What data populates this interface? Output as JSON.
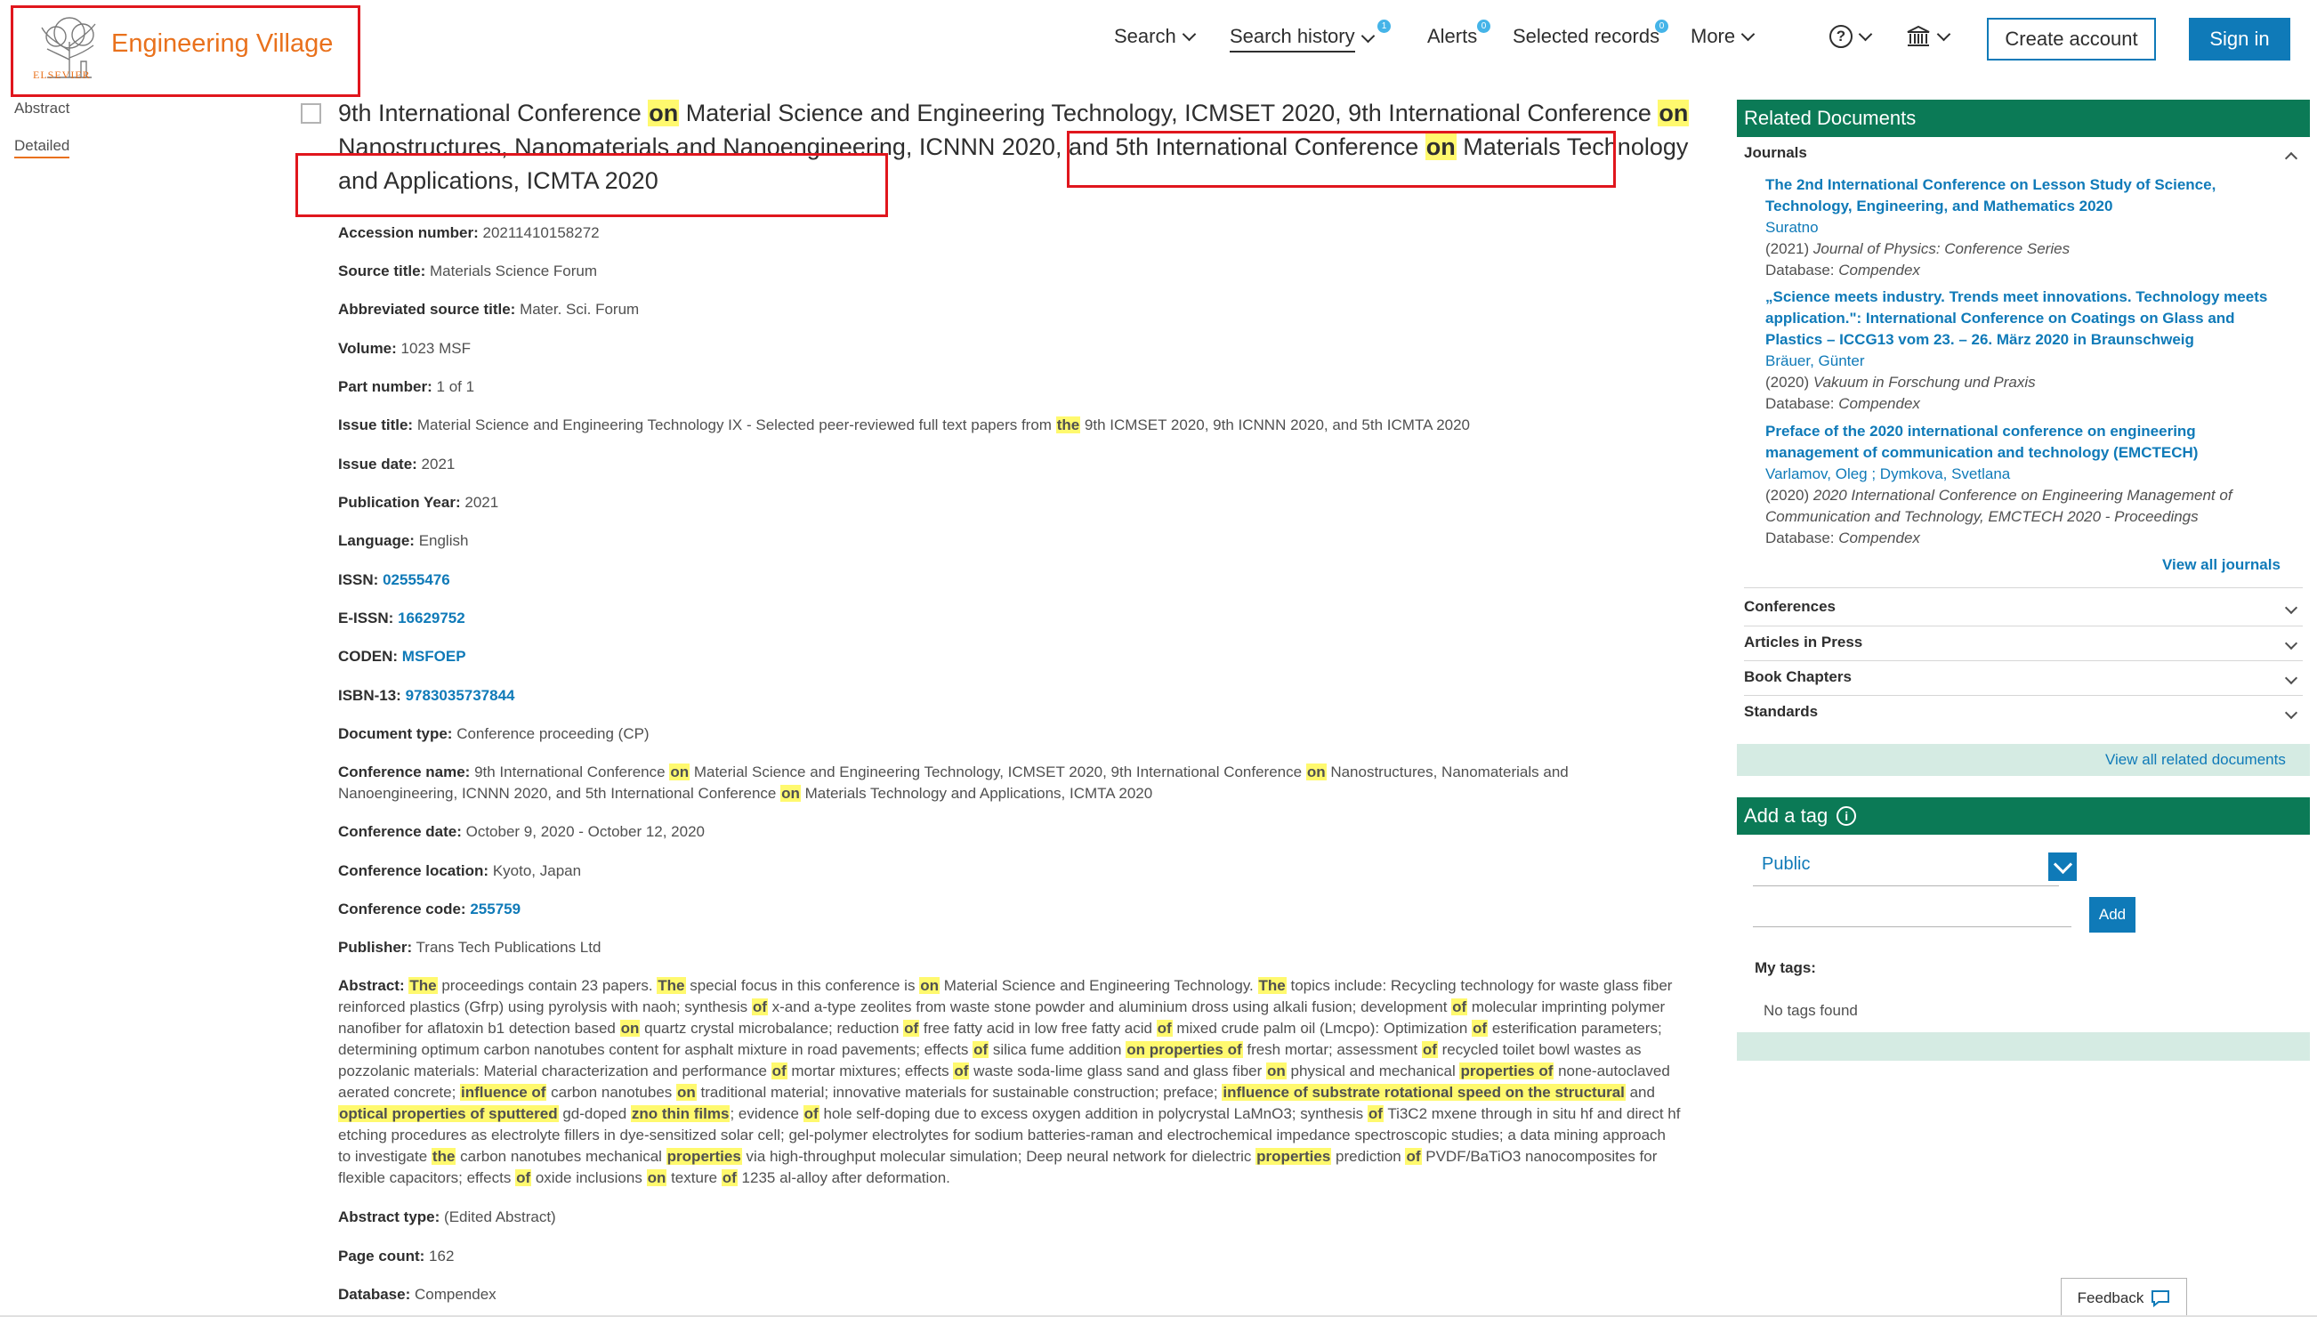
{
  "header": {
    "logo_text": "Engineering Village",
    "logo_sub": "ELSEVIER",
    "nav": {
      "search": "Search",
      "search_history": "Search history",
      "search_history_count": "1",
      "alerts": "Alerts",
      "alerts_count": "0",
      "selected_records": "Selected records",
      "selected_records_count": "0",
      "more": "More",
      "help_icon": "?"
    },
    "create_account": "Create account",
    "sign_in": "Sign in"
  },
  "left_tabs": {
    "abstract": "Abstract",
    "detailed": "Detailed"
  },
  "record": {
    "title_parts": [
      "9th International Conference ",
      "on",
      " Material Science and Engineering Technology, ICMSET 2020, 9th International Conference ",
      "on",
      " Nanostructures, Nanomaterials and Nanoengineering, ICNNN 2020, and 5th International Conference ",
      "on",
      " Materials Technology and Applications, ICMTA 2020"
    ],
    "fields": [
      {
        "label": "Accession number:",
        "value": "20211410158272"
      },
      {
        "label": "Source title:",
        "value": "Materials Science Forum"
      },
      {
        "label": "Abbreviated source title:",
        "value": "Mater. Sci. Forum"
      },
      {
        "label": "Volume:",
        "value": "1023 MSF"
      },
      {
        "label": "Part number:",
        "value": "1 of 1"
      },
      {
        "label": "Issue title:",
        "value": "Material Science and Engineering Technology IX - Selected peer-reviewed full text papers from ",
        "hl": "the",
        "value2": " 9th ICMSET 2020, 9th ICNNN 2020, and 5th ICMTA 2020"
      },
      {
        "label": "Issue date:",
        "value": "2021"
      },
      {
        "label": "Publication Year:",
        "value": "2021"
      },
      {
        "label": "Language:",
        "value": "English"
      },
      {
        "label": "ISSN:",
        "link": "02555476"
      },
      {
        "label": "E-ISSN:",
        "link": "16629752"
      },
      {
        "label": "CODEN:",
        "link": "MSFOEP"
      },
      {
        "label": "ISBN-13:",
        "link": "9783035737844"
      },
      {
        "label": "Document type:",
        "value": "Conference proceeding (CP)"
      }
    ],
    "conference_name_label": "Conference name:",
    "conference_name_parts": [
      "9th International Conference ",
      "on",
      " Material Science and Engineering Technology, ICMSET 2020, 9th International Conference ",
      "on",
      " Nanostructures, Nanomaterials and Nanoengineering, ICNNN 2020, and 5th International Conference ",
      "on",
      " Materials Technology and Applications, ICMTA 2020"
    ],
    "fields2": [
      {
        "label": "Conference date:",
        "value": "October 9, 2020 - October 12, 2020"
      },
      {
        "label": "Conference location:",
        "value": "Kyoto, Japan"
      },
      {
        "label": "Conference code:",
        "link": "255759"
      },
      {
        "label": "Publisher:",
        "value": "Trans Tech Publications Ltd"
      }
    ],
    "abstract_label": "Abstract:",
    "abstract_parts": [
      [
        "h",
        "The"
      ],
      [
        " ",
        " proceedings contain 23 papers. "
      ],
      [
        "h",
        "The"
      ],
      [
        " ",
        " special focus in this conference is "
      ],
      [
        "h",
        "on"
      ],
      [
        " ",
        " Material Science and Engineering Technology. "
      ],
      [
        "h",
        "The"
      ],
      [
        " ",
        " topics include: Recycling technology for waste glass fiber reinforced plastics (Gfrp) using pyrolysis with naoh; synthesis "
      ],
      [
        "h",
        "of"
      ],
      [
        " ",
        " x-and a-type zeolites from waste stone powder and aluminium dross using alkali fusion; development "
      ],
      [
        "h",
        "of"
      ],
      [
        " ",
        " molecular imprinting polymer nanofiber for aflatoxin b1 detection based "
      ],
      [
        "h",
        "on"
      ],
      [
        " ",
        " quartz crystal microbalance; reduction "
      ],
      [
        "h",
        "of"
      ],
      [
        " ",
        " free fatty acid in low free fatty acid "
      ],
      [
        "h",
        "of"
      ],
      [
        " ",
        " mixed crude palm oil (Lmcpo): Optimization "
      ],
      [
        "h",
        "of"
      ],
      [
        " ",
        " esterification parameters; determining optimum carbon nanotubes content for asphalt mixture in road pavements; effects "
      ],
      [
        "h",
        "of"
      ],
      [
        " ",
        " silica fume addition "
      ],
      [
        "h",
        "on properties of"
      ],
      [
        " ",
        " fresh mortar; assessment "
      ],
      [
        "h",
        "of"
      ],
      [
        " ",
        " recycled toilet bowl wastes as pozzolanic materials: Material characterization and performance "
      ],
      [
        "h",
        "of"
      ],
      [
        " ",
        " mortar mixtures; effects "
      ],
      [
        "h",
        "of"
      ],
      [
        " ",
        " waste soda-lime glass sand and glass fiber "
      ],
      [
        "h",
        "on"
      ],
      [
        " ",
        " physical and mechanical "
      ],
      [
        "h",
        "properties of"
      ],
      [
        " ",
        " none-autoclaved aerated concrete; "
      ],
      [
        "h",
        "influence of"
      ],
      [
        " ",
        " carbon nanotubes "
      ],
      [
        "h",
        "on"
      ],
      [
        " ",
        " traditional material; innovative materials for sustainable construction; preface; "
      ],
      [
        "h",
        "influence of substrate rotational speed on the structural"
      ],
      [
        " ",
        " and "
      ],
      [
        "h",
        "optical properties of sputtered"
      ],
      [
        " ",
        " gd-doped "
      ],
      [
        "h",
        "zno thin films"
      ],
      [
        " ",
        "; evidence "
      ],
      [
        "h",
        "of"
      ],
      [
        " ",
        " hole self-doping due to excess oxygen addition in polycrystal LaMnO3; synthesis "
      ],
      [
        "h",
        "of"
      ],
      [
        " ",
        " Ti3C2 mxene through in situ hf and direct hf etching procedures as electrolyte fillers in dye-sensitized solar cell; gel-polymer electrolytes for sodium batteries-raman and electrochemical impedance spectroscopic studies; a data mining approach to investigate "
      ],
      [
        "h",
        "the"
      ],
      [
        " ",
        " carbon nanotubes mechanical "
      ],
      [
        "h",
        "properties"
      ],
      [
        " ",
        " via high-throughput molecular simulation; Deep neural network for dielectric "
      ],
      [
        "h",
        "properties"
      ],
      [
        " ",
        " prediction "
      ],
      [
        "h",
        "of"
      ],
      [
        " ",
        " PVDF/BaTiO3 nanocomposites for flexible capacitors; effects "
      ],
      [
        "h",
        "of"
      ],
      [
        " ",
        " oxide inclusions "
      ],
      [
        "h",
        "on"
      ],
      [
        " ",
        " texture "
      ],
      [
        "h",
        "of"
      ],
      [
        " ",
        " 1235 al-alloy after deformation."
      ]
    ],
    "fields3": [
      {
        "label": "Abstract type:",
        "value": "(Edited Abstract)"
      },
      {
        "label": "Page count:",
        "value": "162"
      },
      {
        "label": "Database:",
        "value": "Compendex"
      }
    ]
  },
  "sidebar": {
    "related_title": "Related Documents",
    "journals_label": "Journals",
    "journals": [
      {
        "title": "The 2nd International Conference on Lesson Study of Science, Technology, Engineering, and Mathematics 2020",
        "authors": "Suratno",
        "year": "(2021) ",
        "source": "Journal of Physics: Conference Series",
        "db": "Database: ",
        "db_name": "Compendex"
      },
      {
        "title": "„Science meets industry. Trends meet innovations. Technology meets application.\": International Conference on Coatings on Glass and Plastics – ICCG13 vom 23. – 26. März 2020 in Braunschweig",
        "authors": "Bräuer, Günter",
        "year": "(2020) ",
        "source": "Vakuum in Forschung und Praxis",
        "db": "Database: ",
        "db_name": "Compendex"
      },
      {
        "title": "Preface of the 2020 international conference on engineering management of communication and technology (EMCTECH)",
        "authors": "Varlamov, Oleg ; Dymkova, Svetlana",
        "year": "(2020) ",
        "source": "2020 International Conference on Engineering Management of Communication and Technology, EMCTECH 2020 - Proceedings",
        "db": "Database: ",
        "db_name": "Compendex"
      }
    ],
    "view_all_journals": "View all journals",
    "sections": [
      "Conferences",
      "Articles in Press",
      "Book Chapters",
      "Standards"
    ],
    "view_all_related": "View all related documents",
    "tag_title": "Add a tag",
    "tag_info_icon": "i",
    "tag_visibility": "Public",
    "add_button": "Add",
    "my_tags": "My tags:",
    "no_tags": "No tags found"
  },
  "feedback": "Feedback"
}
